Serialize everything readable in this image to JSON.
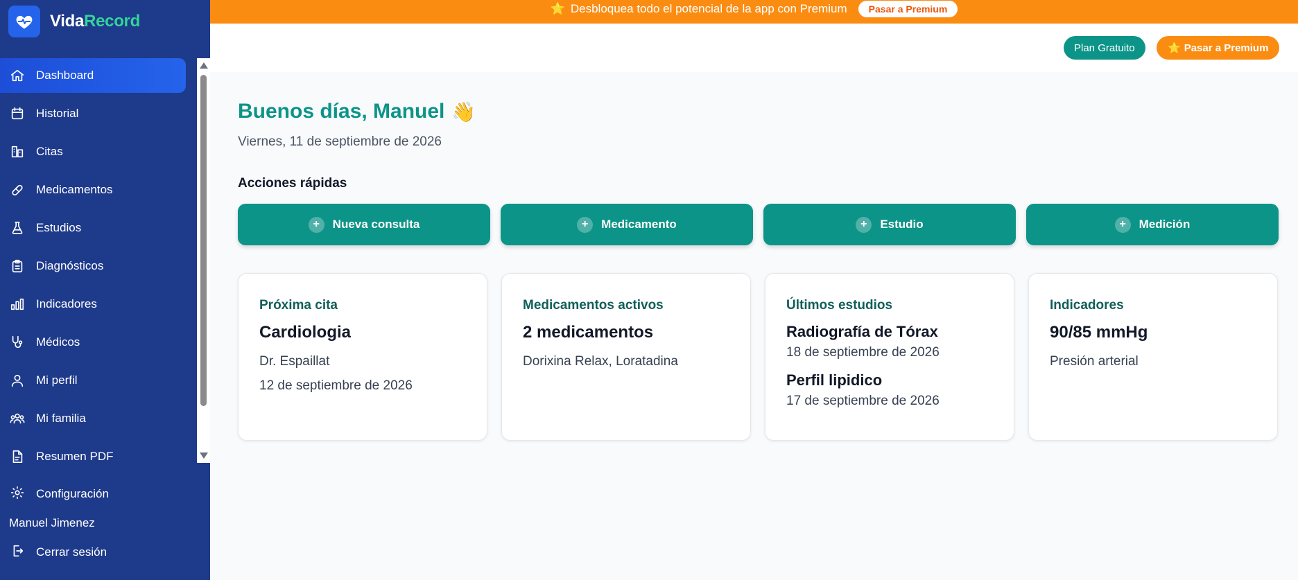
{
  "brand": {
    "prefix": "Vida",
    "suffix": "Record"
  },
  "sidebar": {
    "items": [
      {
        "label": "Dashboard",
        "icon": "home-icon",
        "active": true
      },
      {
        "label": "Historial",
        "icon": "calendar-icon"
      },
      {
        "label": "Citas",
        "icon": "building-icon"
      },
      {
        "label": "Medicamentos",
        "icon": "pill-icon"
      },
      {
        "label": "Estudios",
        "icon": "flask-icon"
      },
      {
        "label": "Diagnósticos",
        "icon": "clipboard-icon"
      },
      {
        "label": "Indicadores",
        "icon": "bar-chart-icon"
      },
      {
        "label": "Médicos",
        "icon": "stethoscope-icon"
      },
      {
        "label": "Mi perfil",
        "icon": "user-icon"
      },
      {
        "label": "Mi familia",
        "icon": "users-icon"
      },
      {
        "label": "Resumen PDF",
        "icon": "file-pdf-icon"
      }
    ],
    "settings_label": "Configuración",
    "user_name": "Manuel Jimenez",
    "logout_label": "Cerrar sesión"
  },
  "banner": {
    "icon": "⭐",
    "text": "Desbloquea todo el potencial de la app con Premium",
    "button_label": "Pasar a Premium"
  },
  "header": {
    "plan_label": "Plan Gratuito",
    "premium_icon": "⭐",
    "premium_label": "Pasar a Premium"
  },
  "main": {
    "greeting": "Buenos días, Manuel",
    "greeting_emoji": "👋",
    "date": "Viernes, 11 de septiembre de 2026",
    "quick_actions_title": "Acciones rápidas",
    "quick_actions": [
      {
        "label": "Nueva consulta"
      },
      {
        "label": "Medicamento"
      },
      {
        "label": "Estudio"
      },
      {
        "label": "Medición"
      }
    ],
    "cards": {
      "next_appointment": {
        "label": "Próxima cita",
        "value": "Cardiologia",
        "doctor": "Dr. Espaillat",
        "date": "12 de septiembre de 2026"
      },
      "active_meds": {
        "label": "Medicamentos activos",
        "value": "2 medicamentos",
        "list": "Dorixina Relax, Loratadina"
      },
      "latest_studies": {
        "label": "Últimos estudios",
        "studies": [
          {
            "name": "Radiografía de Tórax",
            "date": "18 de septiembre de 2026"
          },
          {
            "name": "Perfil lipidico",
            "date": "17 de septiembre de 2026"
          }
        ]
      },
      "indicators": {
        "label": "Indicadores",
        "value": "90/85 mmHg",
        "desc": "Presión arterial"
      }
    }
  },
  "colors": {
    "sidebar": "#1e3a8a",
    "active": "#2563eb",
    "teal": "#0d9488",
    "orange": "#fb8c12"
  }
}
